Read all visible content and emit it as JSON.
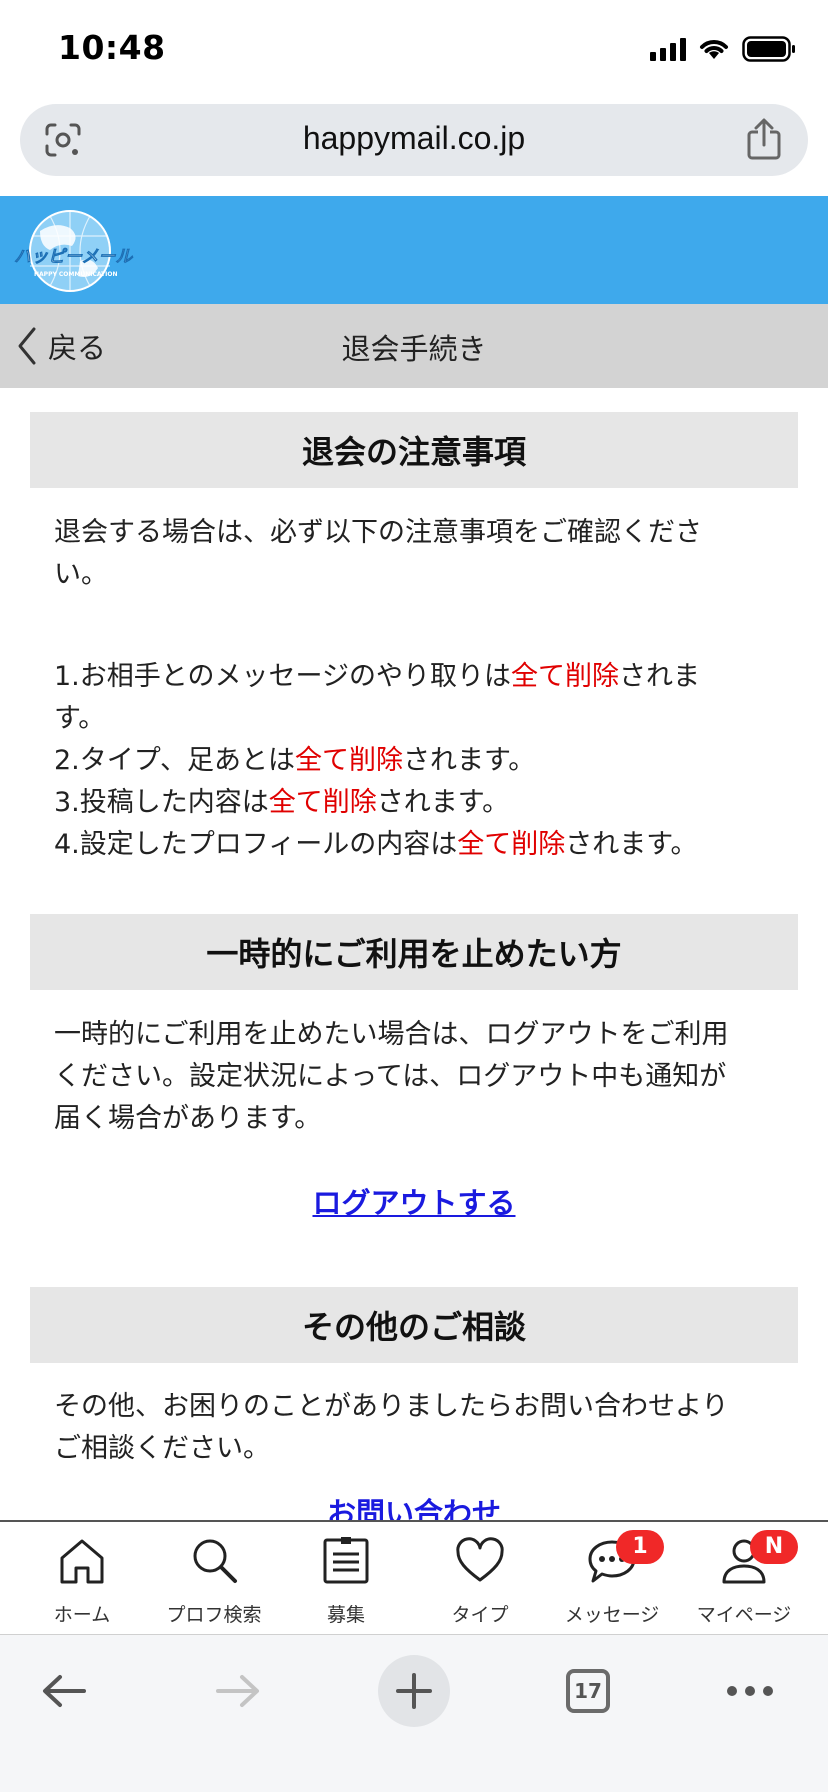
{
  "status": {
    "time": "10:48"
  },
  "browser": {
    "url": "happymail.co.jp",
    "tab_count": "17"
  },
  "header": {
    "logo_text": "ハッピーメール",
    "logo_sub": "HAPPY COMMUNICATION"
  },
  "titlebar": {
    "back_label": "戻る",
    "title": "退会手続き"
  },
  "sections": {
    "notice": {
      "heading": "退会の注意事項",
      "intro_line1": "退会する場合は、必ず以下の注意事項をご確認くださ",
      "intro_line2": "い。",
      "item1_a": "1.お相手とのメッセージのやり取りは",
      "item1_red": "全て削除",
      "item1_b": "されま",
      "item1_c": "す。",
      "item2_a": "2.タイプ、足あとは",
      "item2_red": "全て削除",
      "item2_b": "されます。",
      "item3_a": "3.投稿した内容は",
      "item3_red": "全て削除",
      "item3_b": "されます。",
      "item4_a": "4.設定したプロフィールの内容は",
      "item4_red": "全て削除",
      "item4_b": "されます。"
    },
    "pause": {
      "heading": "一時的にご利用を止めたい方",
      "line1": "一時的にご利用を止めたい場合は、ログアウトをご利用",
      "line2": "ください。設定状況によっては、ログアウト中も通知が",
      "line3": "届く場合があります。",
      "logout_link": "ログアウトする"
    },
    "other": {
      "heading": "その他のご相談",
      "line1": "その他、お困りのことがありましたらお問い合わせより",
      "line2": "ご相談ください。",
      "contact_link": "お問い合わせ"
    }
  },
  "nav": {
    "home": "ホーム",
    "search": "プロフ検索",
    "board": "募集",
    "type": "タイプ",
    "message": "メッセージ",
    "mypage": "マイページ",
    "message_badge": "1",
    "mypage_badge": "N"
  },
  "colors": {
    "header_blue": "#3ea9ec",
    "alert_red": "#e00000",
    "link_blue": "#1a1adf",
    "badge_red": "#f02828"
  },
  "icons": [
    "signal-icon",
    "wifi-icon",
    "battery-icon",
    "lens-icon",
    "share-icon",
    "back-chevron-icon",
    "home-icon",
    "search-icon",
    "board-icon",
    "heart-icon",
    "message-icon",
    "person-icon",
    "arrow-left-icon",
    "arrow-right-icon",
    "plus-icon",
    "tabs-icon",
    "more-icon"
  ]
}
